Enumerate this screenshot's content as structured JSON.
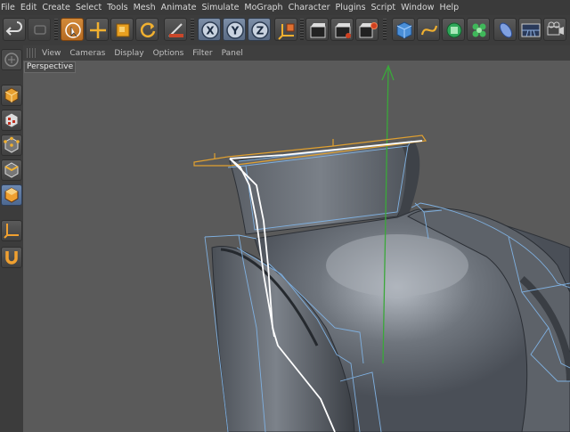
{
  "menu": {
    "items": [
      "File",
      "Edit",
      "Create",
      "Select",
      "Tools",
      "Mesh",
      "Animate",
      "Simulate",
      "MoGraph",
      "Character",
      "Plugins",
      "Script",
      "Window",
      "Help"
    ]
  },
  "toolbar": {
    "groups": [
      {
        "icons": [
          "undo-icon",
          "redo-icon"
        ]
      },
      {
        "icons": [
          "live-selection-icon",
          "move-icon",
          "scale-icon",
          "rotate-icon",
          "last-tool-icon"
        ]
      },
      {
        "icons": [
          "x-axis-lock-icon",
          "y-axis-lock-icon",
          "z-axis-lock-icon",
          "coordinate-system-icon"
        ]
      },
      {
        "icons": [
          "render-view-icon",
          "render-picture-viewer-icon",
          "render-settings-icon"
        ]
      },
      {
        "icons": [
          "cube-object-icon",
          "spline-pen-icon",
          "nurbs-icon",
          "array-icon",
          "deformer-icon",
          "floor-icon",
          "camera-icon"
        ]
      }
    ],
    "axis_labels": [
      "X",
      "Y",
      "Z"
    ],
    "accent_color": "#d2883a",
    "axis_button_color": "#6d7f99"
  },
  "left_palette": {
    "icons": [
      "make-editable-icon",
      "texture-mode-icon",
      "points-mode-icon",
      "edges-mode-icon",
      "polygons-mode-icon",
      "axis-mode-icon",
      "magnet-icon"
    ],
    "active": "polygons-mode-icon"
  },
  "viewport": {
    "menu": [
      "View",
      "Cameras",
      "Display",
      "Options",
      "Filter",
      "Panel"
    ],
    "label": "Perspective",
    "background": "#5a5a5a",
    "y_axis_color": "#3aa83a",
    "selection_color": "#e0a030",
    "bounding_box_color": "#7fb0e0"
  }
}
